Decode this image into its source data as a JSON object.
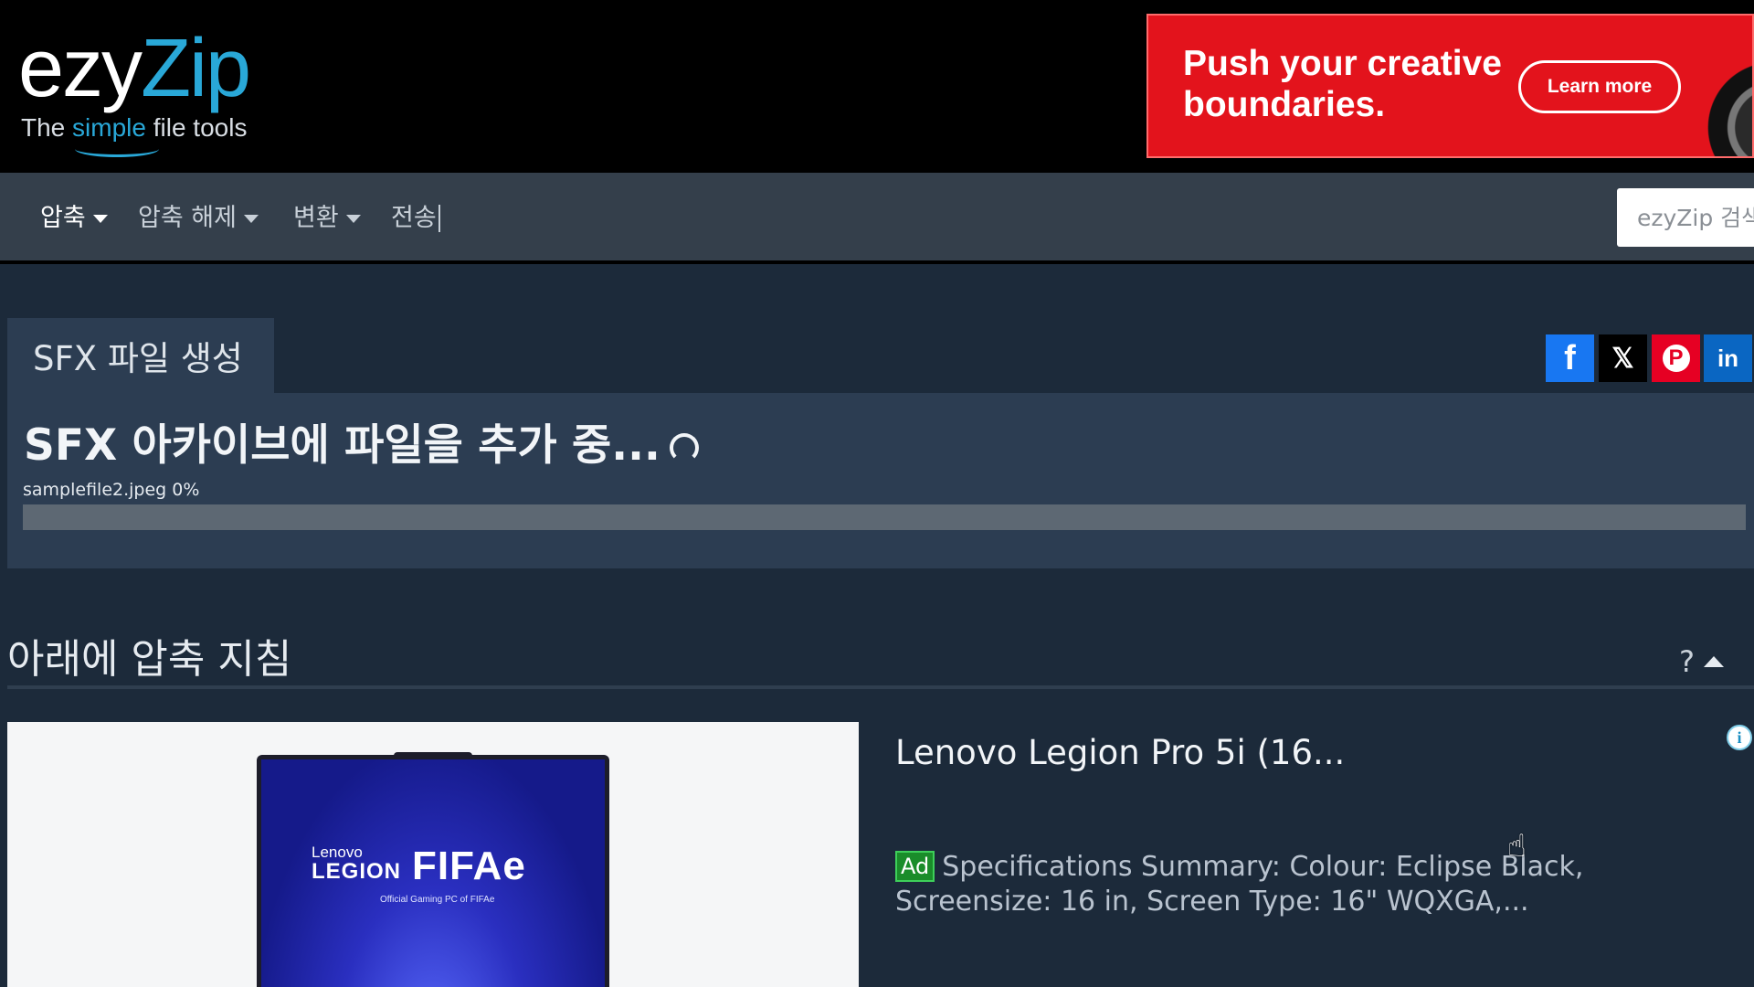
{
  "header": {
    "logo": {
      "main_ezy": "ezy",
      "main_zip": "Zip",
      "tag_before": "The ",
      "tag_simple": "simple",
      "tag_after": " file tools"
    },
    "ad_banner": {
      "headline": "Push your creative boundaries.",
      "button_label": "Learn more"
    }
  },
  "nav": {
    "items": [
      {
        "label": "압축",
        "has_dropdown": true,
        "active": true
      },
      {
        "label": "압축 해제",
        "has_dropdown": true
      },
      {
        "label": "변환",
        "has_dropdown": true
      },
      {
        "label": "전송",
        "has_dropdown": false
      }
    ],
    "search": {
      "placeholder": "ezyZip 검색"
    }
  },
  "tool": {
    "tab_title": "SFX 파일 생성",
    "share_icons": [
      "facebook-icon",
      "x-icon",
      "pinterest-icon",
      "linkedin-icon"
    ],
    "progress_title": "SFX 아카이브에 파일을 추가 중...",
    "file_name": "samplefile2.jpeg",
    "file_percent": "0%",
    "progress": 0
  },
  "instructions": {
    "title": "아래에 압축 지침",
    "help_label": "?"
  },
  "native_ad": {
    "image_text": {
      "lenovo": "Lenovo",
      "legion": "LEGION",
      "fifa": "FIFAe",
      "sub": "Official Gaming PC of FIFAe"
    },
    "title": "Lenovo Legion Pro 5i (16...",
    "badge": "Ad",
    "body": "Specifications Summary: Colour: Eclipse Black, Screensize: 16 in, Screen Type: 16\" WQXGA,...",
    "info_icon": "i"
  },
  "colors": {
    "accent": "#29a8d8",
    "page_bg": "#1c2a3a",
    "panel_bg": "#2c3d52",
    "nav_bg": "#343f4b",
    "ad_red": "#e3131c"
  }
}
